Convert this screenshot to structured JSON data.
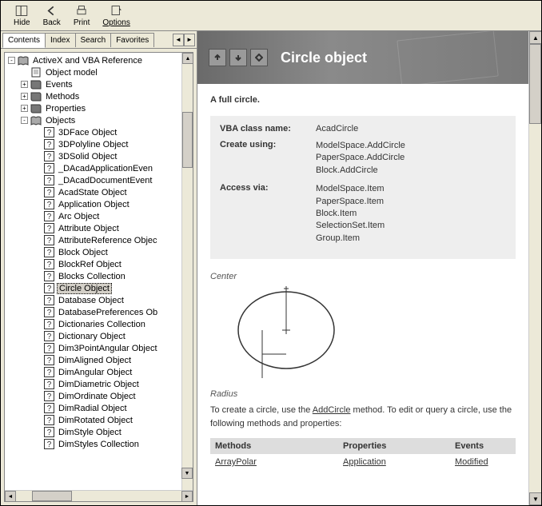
{
  "toolbar": {
    "hide": "Hide",
    "back": "Back",
    "print": "Print",
    "options": "Options"
  },
  "tabs": {
    "items": [
      "Contents",
      "Index",
      "Search",
      "Favorites"
    ],
    "active_index": 0
  },
  "tree": {
    "root_label": "ActiveX and VBA Reference",
    "nodes": [
      {
        "depth": 1,
        "exp": "-",
        "icon": "book-open",
        "label": "ActiveX and VBA Reference"
      },
      {
        "depth": 2,
        "exp": null,
        "icon": "page",
        "label": "Object model"
      },
      {
        "depth": 2,
        "exp": "+",
        "icon": "book",
        "label": "Events"
      },
      {
        "depth": 2,
        "exp": "+",
        "icon": "book",
        "label": "Methods"
      },
      {
        "depth": 2,
        "exp": "+",
        "icon": "book",
        "label": "Properties"
      },
      {
        "depth": 2,
        "exp": "-",
        "icon": "book-open",
        "label": "Objects"
      },
      {
        "depth": 3,
        "exp": null,
        "icon": "help",
        "label": "3DFace Object"
      },
      {
        "depth": 3,
        "exp": null,
        "icon": "help",
        "label": "3DPolyline Object"
      },
      {
        "depth": 3,
        "exp": null,
        "icon": "help",
        "label": "3DSolid Object"
      },
      {
        "depth": 3,
        "exp": null,
        "icon": "help",
        "label": "_DAcadApplicationEven"
      },
      {
        "depth": 3,
        "exp": null,
        "icon": "help",
        "label": "_DAcadDocumentEvent"
      },
      {
        "depth": 3,
        "exp": null,
        "icon": "help",
        "label": "AcadState Object"
      },
      {
        "depth": 3,
        "exp": null,
        "icon": "help",
        "label": "Application Object"
      },
      {
        "depth": 3,
        "exp": null,
        "icon": "help",
        "label": "Arc Object"
      },
      {
        "depth": 3,
        "exp": null,
        "icon": "help",
        "label": "Attribute Object"
      },
      {
        "depth": 3,
        "exp": null,
        "icon": "help",
        "label": "AttributeReference Objec"
      },
      {
        "depth": 3,
        "exp": null,
        "icon": "help",
        "label": "Block Object"
      },
      {
        "depth": 3,
        "exp": null,
        "icon": "help",
        "label": "BlockRef Object"
      },
      {
        "depth": 3,
        "exp": null,
        "icon": "help",
        "label": "Blocks Collection"
      },
      {
        "depth": 3,
        "exp": null,
        "icon": "help",
        "label": "Circle Object",
        "selected": true
      },
      {
        "depth": 3,
        "exp": null,
        "icon": "help",
        "label": "Database Object"
      },
      {
        "depth": 3,
        "exp": null,
        "icon": "help",
        "label": "DatabasePreferences Ob"
      },
      {
        "depth": 3,
        "exp": null,
        "icon": "help",
        "label": "Dictionaries Collection"
      },
      {
        "depth": 3,
        "exp": null,
        "icon": "help",
        "label": "Dictionary Object"
      },
      {
        "depth": 3,
        "exp": null,
        "icon": "help",
        "label": "Dim3PointAngular Object"
      },
      {
        "depth": 3,
        "exp": null,
        "icon": "help",
        "label": "DimAligned Object"
      },
      {
        "depth": 3,
        "exp": null,
        "icon": "help",
        "label": "DimAngular Object"
      },
      {
        "depth": 3,
        "exp": null,
        "icon": "help",
        "label": "DimDiametric Object"
      },
      {
        "depth": 3,
        "exp": null,
        "icon": "help",
        "label": "DimOrdinate Object"
      },
      {
        "depth": 3,
        "exp": null,
        "icon": "help",
        "label": "DimRadial Object"
      },
      {
        "depth": 3,
        "exp": null,
        "icon": "help",
        "label": "DimRotated Object"
      },
      {
        "depth": 3,
        "exp": null,
        "icon": "help",
        "label": "DimStyle Object"
      },
      {
        "depth": 3,
        "exp": null,
        "icon": "help",
        "label": "DimStyles Collection"
      }
    ]
  },
  "doc": {
    "title": "Circle object",
    "lead": "A full circle.",
    "info": {
      "class_key": "VBA class name:",
      "class_val": "AcadCircle",
      "create_key": "Create using:",
      "create_vals": [
        "ModelSpace.AddCircle",
        "PaperSpace.AddCircle",
        "Block.AddCircle"
      ],
      "access_key": "Access via:",
      "access_vals": [
        "ModelSpace.Item",
        "PaperSpace.Item",
        "Block.Item",
        "SelectionSet.Item",
        "Group.Item"
      ]
    },
    "caption_center": "Center",
    "caption_radius": "Radius",
    "para_pre": "To create a circle, use the ",
    "para_link": "AddCircle",
    "para_mid": " method. To edit or query a circle, use the following methods and properties:",
    "table": {
      "headers": [
        "Methods",
        "Properties",
        "Events"
      ],
      "row0": [
        "ArrayPolar",
        "Application",
        "Modified"
      ]
    }
  }
}
